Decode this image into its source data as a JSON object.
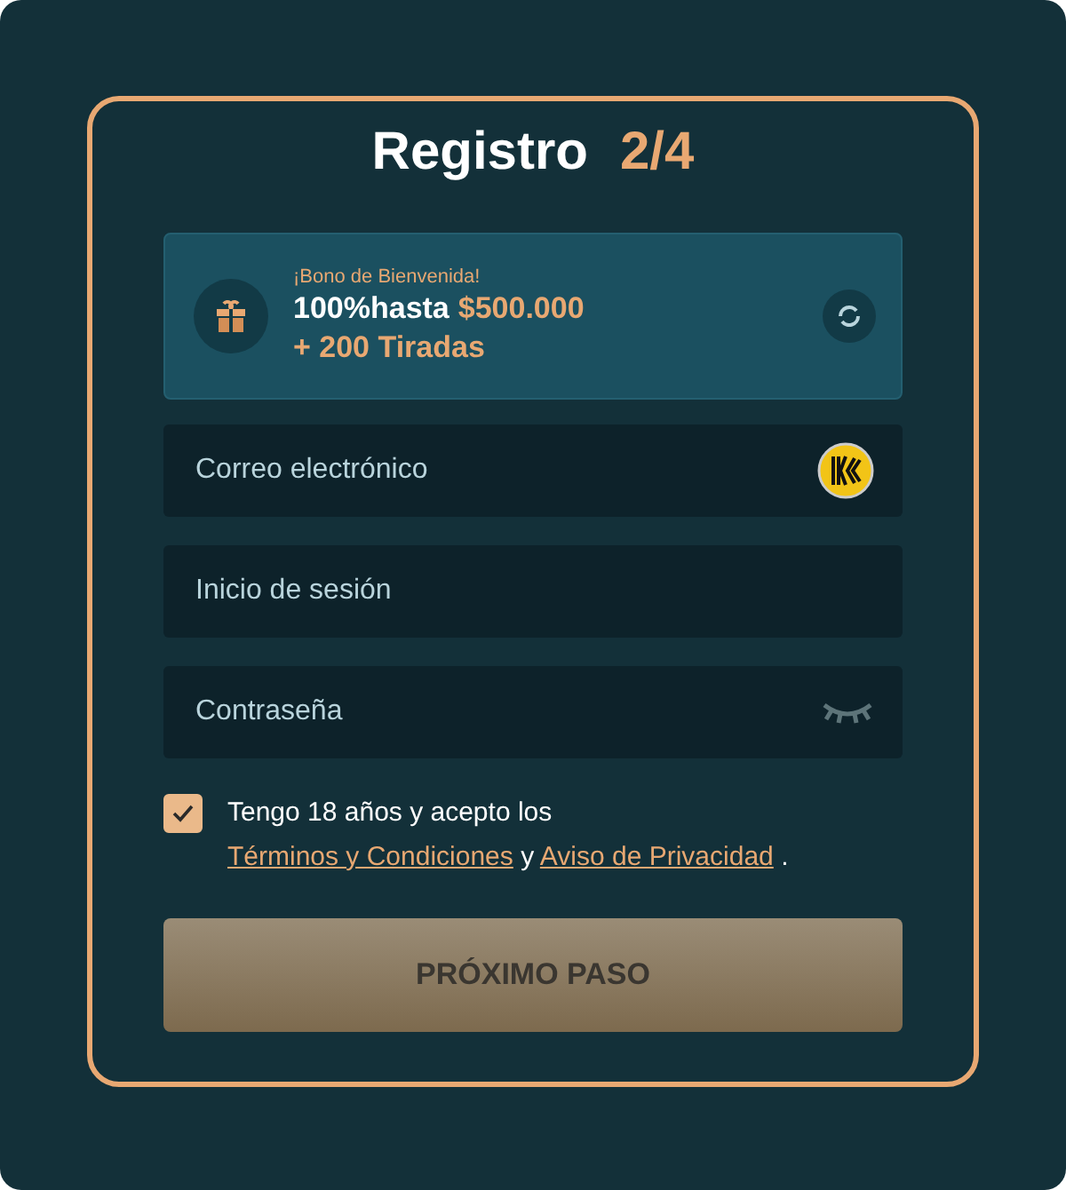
{
  "title": {
    "text": "Registro",
    "step": "2/4"
  },
  "bonus": {
    "label": "¡Bono de Bienvenida!",
    "headline": "100%hasta",
    "amount": "$500.000",
    "extra": "+ 200 Tiradas"
  },
  "fields": [
    {
      "placeholder": "Correo electrónico",
      "kind": "email"
    },
    {
      "placeholder": "Inicio de sesión",
      "kind": "text"
    },
    {
      "placeholder": "Contraseña",
      "kind": "password"
    }
  ],
  "consent": {
    "checked": true,
    "parts": [
      {
        "kind": "text",
        "text": "Tengo 18 años y acepto los"
      },
      {
        "kind": "link",
        "text": "Términos y Condiciones"
      },
      {
        "kind": "text",
        "text": "y"
      },
      {
        "kind": "link",
        "text": "Aviso de Privacidad"
      },
      {
        "kind": "text",
        "text": "."
      }
    ]
  },
  "button": {
    "label": "PRÓXIMO PASO",
    "disabled": true
  }
}
